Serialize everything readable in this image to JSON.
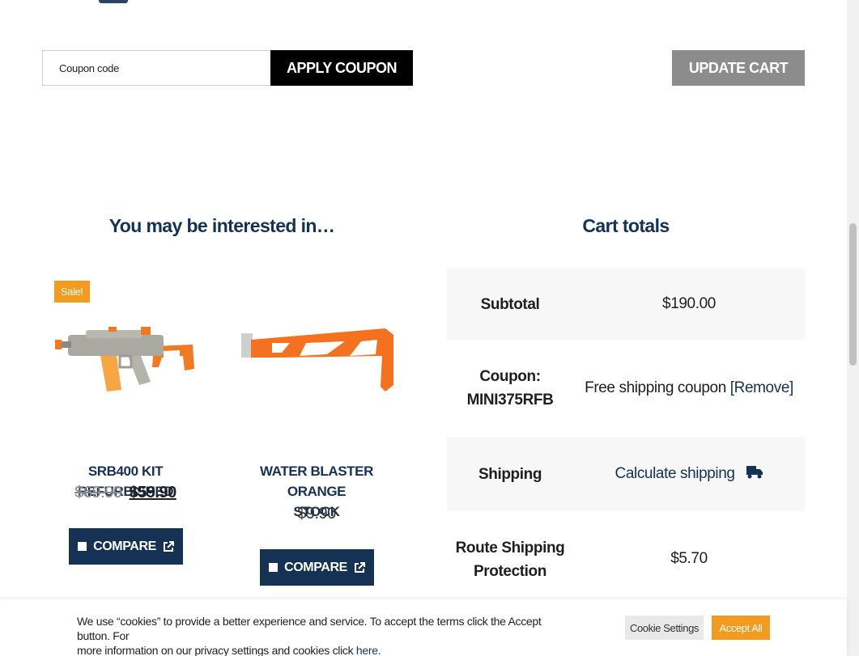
{
  "coupon": {
    "placeholder": "Coupon code",
    "apply_label": "APPLY COUPON",
    "update_label": "UPDATE CART"
  },
  "related": {
    "heading": "You may be interested in…",
    "products": [
      {
        "badge": "Sale!",
        "name": "SRB400 KIT REFURBISHED",
        "price_old": "$69.90",
        "price_new": "$59.90",
        "compare_label": "COMPARE"
      },
      {
        "name_line1": "WATER BLASTER ORANGE",
        "name_line2": "STOCK",
        "price": "$9.90",
        "compare_label": "COMPARE"
      }
    ]
  },
  "totals": {
    "heading": "Cart totals",
    "rows": [
      {
        "label": "Subtotal",
        "value": "$190.00"
      },
      {
        "label_line1": "Coupon:",
        "label_line2": "MINI375RFB",
        "value": "Free shipping coupon",
        "link": "[Remove]"
      },
      {
        "label": "Shipping",
        "value": "Calculate shipping"
      },
      {
        "label_line1": "Route Shipping",
        "label_line2": "Protection",
        "value": "$5.70"
      }
    ]
  },
  "cookie": {
    "text_line1": "We use “cookies” to provide a better experience and service. To accept the terms click the Accept button. For",
    "text_line2": "more information on our privacy settings and cookies click",
    "link": "here",
    "period": ".",
    "settings_label": "Cookie Settings",
    "accept_label": "Accept All"
  },
  "colors": {
    "brand_navy": "#153255",
    "accent_orange": "#f29b1e",
    "button_black": "#000000",
    "button_gray": "#8c8c8c"
  }
}
